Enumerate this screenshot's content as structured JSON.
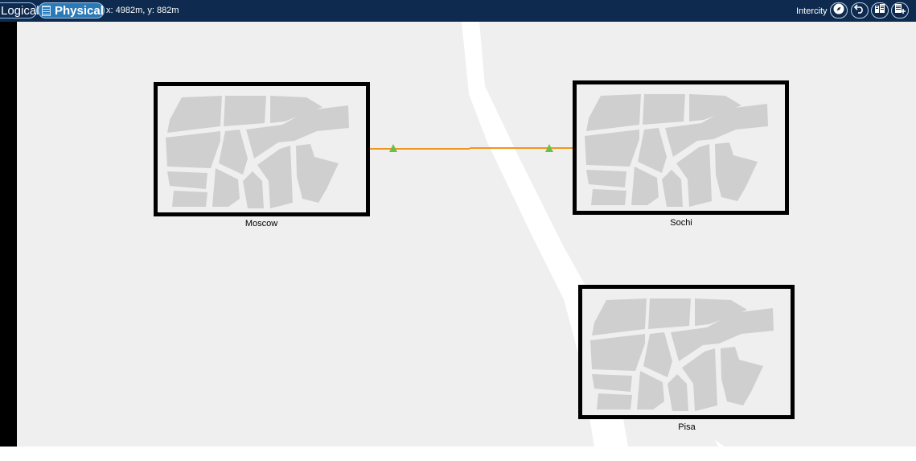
{
  "toolbar": {
    "tab_logical": "Logical",
    "tab_physical": "Physical",
    "coordinates": "x: 4982m, y: 882m",
    "location_mode": "Intercity",
    "buttons": [
      {
        "icon": "compass-icon"
      },
      {
        "icon": "undo-icon"
      },
      {
        "icon": "city-icon"
      },
      {
        "icon": "add-cabinet-icon"
      }
    ]
  },
  "colors": {
    "topbar": "#0e2a4e",
    "canvas": "#efefef",
    "connection": "#f0961e",
    "marker": "#6cbf45"
  },
  "cities": [
    {
      "name": "Moscow"
    },
    {
      "name": "Sochi"
    },
    {
      "name": "Pisa"
    }
  ]
}
